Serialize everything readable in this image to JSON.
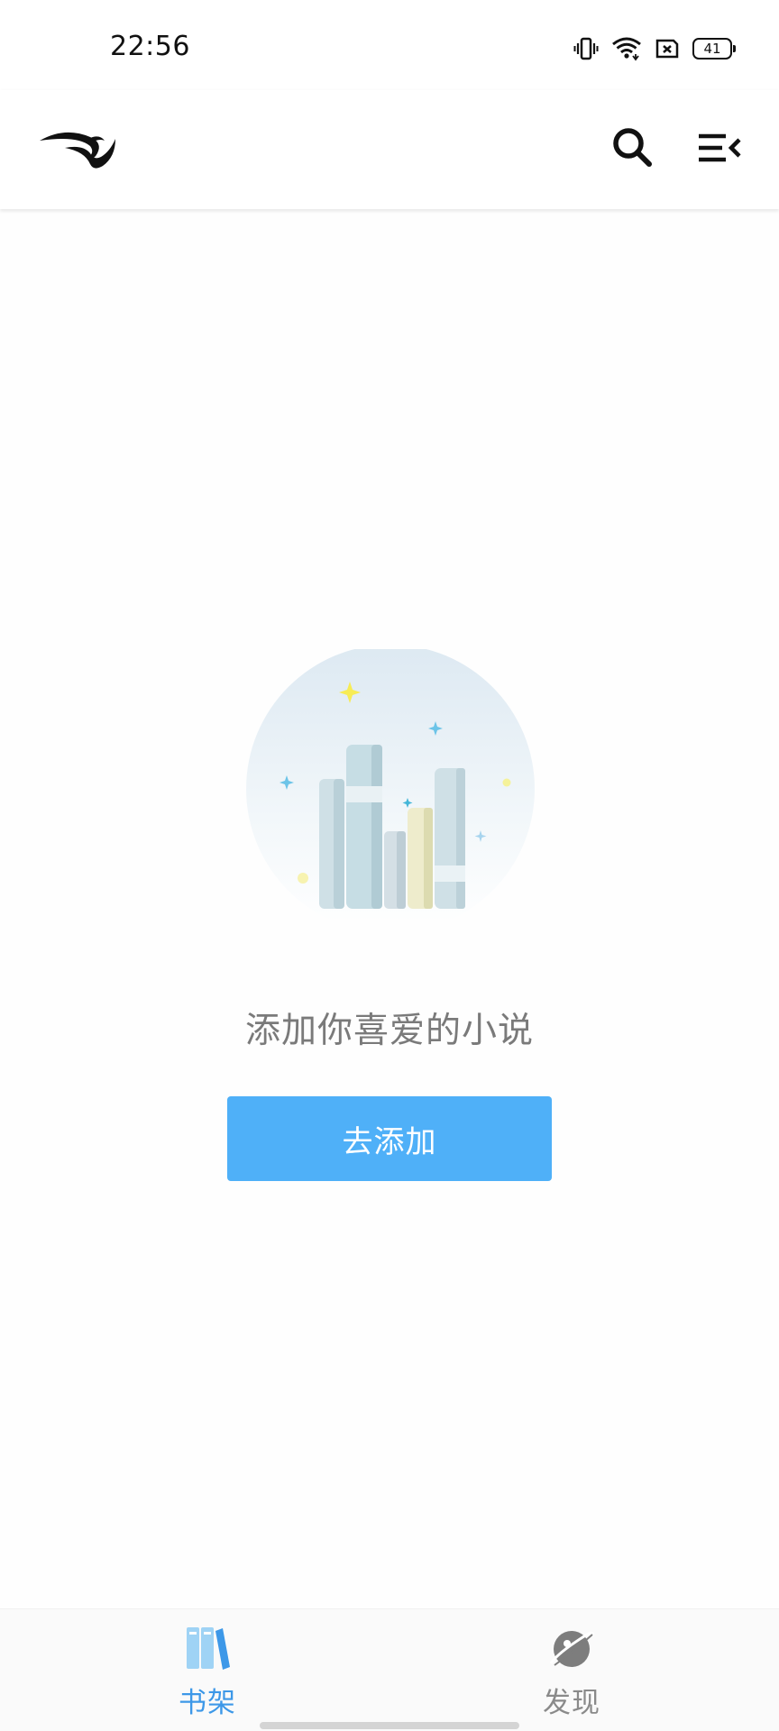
{
  "status_bar": {
    "time": "22:56",
    "battery_level": "41",
    "icons": [
      "vibrate-icon",
      "wifi-icon",
      "sim-off-icon",
      "battery-icon"
    ]
  },
  "app_bar": {
    "logo_icon": "bird-logo-icon",
    "search_icon": "search-icon",
    "menu_icon": "menu-collapse-icon"
  },
  "empty_state": {
    "illustration_icon": "books-illustration-icon",
    "message": "添加你喜爱的小说",
    "button_label": "去添加",
    "button_color": "#4fb0f8"
  },
  "bottom_nav": {
    "items": [
      {
        "label": "书架",
        "icon": "bookshelf-icon",
        "active": true,
        "color": "#3d98e8"
      },
      {
        "label": "发现",
        "icon": "planet-icon",
        "active": false,
        "color": "#8a8a8a"
      }
    ]
  }
}
